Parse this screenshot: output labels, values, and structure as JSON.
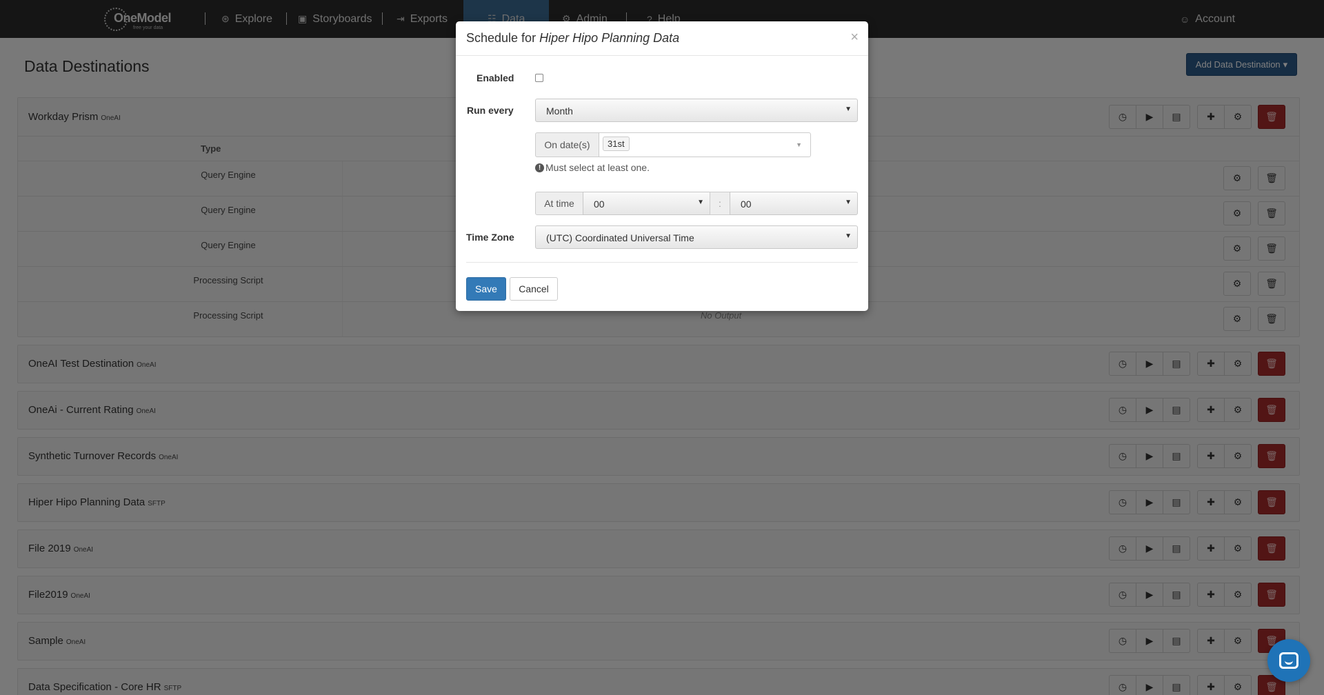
{
  "nav": {
    "logo_text": "OneModel",
    "logo_tagline": "free your data",
    "items": [
      {
        "label": "Explore",
        "icon": "compass-icon",
        "glyph": "⊛"
      },
      {
        "label": "Storyboards",
        "icon": "storyboard-icon",
        "glyph": "▣"
      },
      {
        "label": "Exports",
        "icon": "export-icon",
        "glyph": "⇥"
      },
      {
        "label": "Data",
        "icon": "data-icon",
        "glyph": "☷"
      },
      {
        "label": "Admin",
        "icon": "gear-icon",
        "glyph": "⚙"
      },
      {
        "label": "Help",
        "icon": "help-icon",
        "glyph": "?"
      }
    ],
    "account": {
      "label": "Account",
      "glyph": "☺"
    }
  },
  "page": {
    "title": "Data Destinations",
    "add_button": "Add Data Destination"
  },
  "destinations": [
    {
      "name": "Workday Prism",
      "tag": "OneAI"
    },
    {
      "name": "OneAI Test Destination",
      "tag": "OneAI"
    },
    {
      "name": "OneAi -  Current Rating",
      "tag": "OneAI"
    },
    {
      "name": "Synthetic Turnover Records",
      "tag": "OneAI"
    },
    {
      "name": "Hiper Hipo Planning Data",
      "tag": "SFTP"
    },
    {
      "name": "File 2019",
      "tag": "OneAI"
    },
    {
      "name": "File2019",
      "tag": "OneAI"
    },
    {
      "name": "Sample",
      "tag": "OneAI"
    },
    {
      "name": "Data Specification - Core HR",
      "tag": "SFTP"
    }
  ],
  "subtable": {
    "header_type": "Type",
    "rows": [
      {
        "type": "Query Engine",
        "output": ""
      },
      {
        "type": "Query Engine",
        "output": ""
      },
      {
        "type": "Query Engine",
        "output": ""
      },
      {
        "type": "Processing Script",
        "output": ""
      },
      {
        "type": "Processing Script",
        "output": "No Output"
      }
    ]
  },
  "modal": {
    "title_prefix": "Schedule for ",
    "title_name": "Hiper Hipo Planning Data",
    "close_glyph": "×",
    "enabled_label": "Enabled",
    "enabled_checked": false,
    "run_every_label": "Run every",
    "run_every_value": "Month",
    "on_dates_label": "On date(s)",
    "selected_dates": [
      "31st"
    ],
    "help_text": "Must select at least one.",
    "at_time_label": "At time",
    "hour_value": "00",
    "time_separator": ":",
    "minute_value": "00",
    "timezone_label": "Time Zone",
    "timezone_value": "(UTC) Coordinated Universal Time",
    "save_label": "Save",
    "cancel_label": "Cancel"
  },
  "colors": {
    "nav_bg": "#2b2b2b",
    "nav_active": "#3b6a93",
    "primary": "#337ab7",
    "danger": "#a52a2a",
    "chat": "#1f73b7"
  }
}
